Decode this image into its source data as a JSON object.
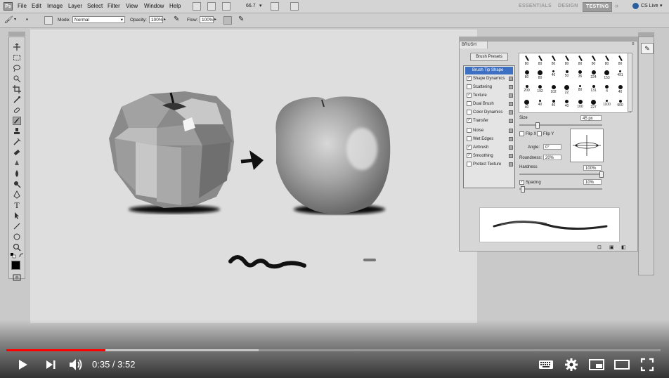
{
  "menu": {
    "ps_logo": "Ps",
    "items": [
      "File",
      "Edit",
      "Image",
      "Layer",
      "Select",
      "Filter",
      "View",
      "Window",
      "Help"
    ],
    "zoom": "66.7",
    "workspaces": [
      "ESSENTIALS",
      "DESIGN",
      "TESTING"
    ],
    "active_workspace": "TESTING",
    "cs_live": "CS Live"
  },
  "options": {
    "mode_label": "Mode:",
    "mode_value": "Normal",
    "opacity_label": "Opacity:",
    "opacity_value": "100%",
    "flow_label": "Flow:",
    "flow_value": "100%"
  },
  "brush_panel": {
    "title": "BRUSH",
    "presets_button": "Brush Presets",
    "options": [
      {
        "label": "Brush Tip Shape",
        "checked": null,
        "selected": true
      },
      {
        "label": "Shape Dynamics",
        "checked": true
      },
      {
        "label": "Scattering",
        "checked": false
      },
      {
        "label": "Texture",
        "checked": true
      },
      {
        "label": "Dual Brush",
        "checked": false
      },
      {
        "label": "Color Dynamics",
        "checked": false
      },
      {
        "label": "Transfer",
        "checked": true
      },
      {
        "label": "Noise",
        "checked": false
      },
      {
        "label": "Wet Edges",
        "checked": false
      },
      {
        "label": "Airbrush",
        "checked": true
      },
      {
        "label": "Smoothing",
        "checked": true
      },
      {
        "label": "Protect Texture",
        "checked": false
      }
    ],
    "preset_sizes": [
      "80",
      "80",
      "80",
      "80",
      "80",
      "80",
      "80",
      "80",
      "80",
      "80",
      "40",
      "50",
      "35",
      "224",
      "153",
      "491",
      "200",
      "192",
      "102",
      "22",
      "80",
      "131",
      "4",
      "40",
      "40",
      "40",
      "40",
      "40",
      "100",
      "227",
      "1100",
      "900"
    ],
    "size_label": "Size",
    "size_value": "45 px",
    "flip_x": "Flip X",
    "flip_y": "Flip Y",
    "angle_label": "Angle:",
    "angle_value": "0°",
    "roundness_label": "Roundness:",
    "roundness_value": "20%",
    "hardness_label": "Hardness",
    "hardness_value": "100%",
    "spacing_label": "Spacing",
    "spacing_value": "10%"
  },
  "video": {
    "current_time": "0:35",
    "duration": "3:52",
    "time_display": "0:35 / 3:52",
    "played_fraction": 0.151,
    "buffered_fraction": 0.386
  }
}
